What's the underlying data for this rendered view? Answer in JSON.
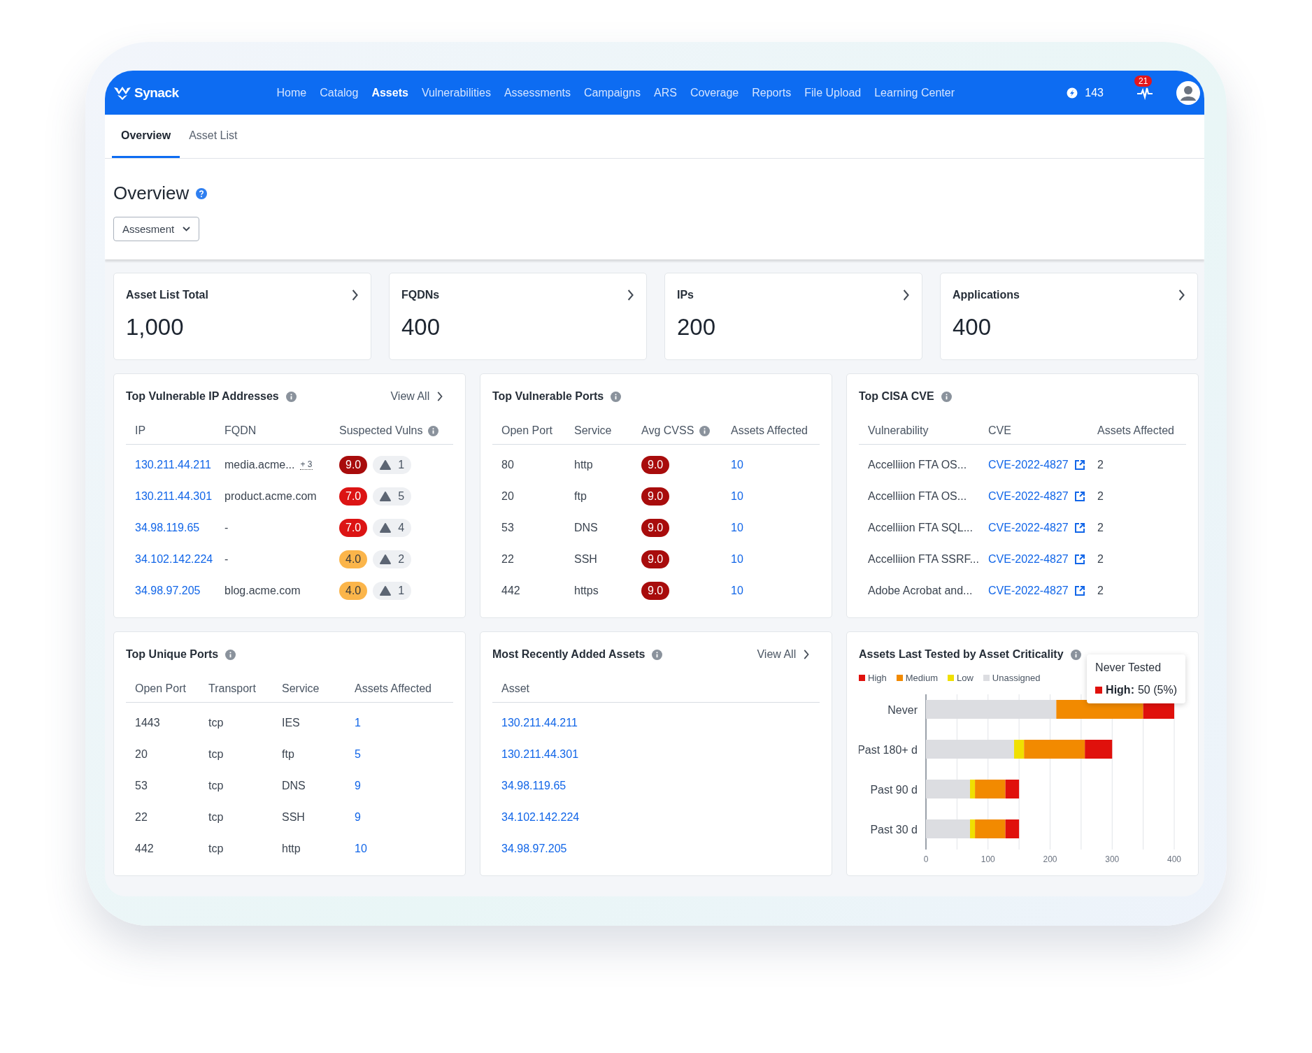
{
  "nav": {
    "logo": "Synack",
    "items": [
      {
        "label": "Home",
        "selected": false
      },
      {
        "label": "Catalog",
        "selected": false
      },
      {
        "label": "Assets",
        "selected": true
      },
      {
        "label": "Vulnerabilities",
        "selected": false
      },
      {
        "label": "Assessments",
        "selected": false
      },
      {
        "label": "Campaigns",
        "selected": false
      },
      {
        "label": "ARS",
        "selected": false
      },
      {
        "label": "Coverage",
        "selected": false
      },
      {
        "label": "Reports",
        "selected": false
      },
      {
        "label": "File Upload",
        "selected": false
      },
      {
        "label": "Learning Center",
        "selected": false
      }
    ],
    "points": "143",
    "notifications": "21"
  },
  "tabs": [
    {
      "label": "Overview",
      "selected": true
    },
    {
      "label": "Asset List",
      "selected": false
    }
  ],
  "page": {
    "title": "Overview",
    "filter": "Assesment"
  },
  "stats": [
    {
      "label": "Asset List Total",
      "value": "1,000"
    },
    {
      "label": "FQDNs",
      "value": "400"
    },
    {
      "label": "IPs",
      "value": "200"
    },
    {
      "label": "Applications",
      "value": "400"
    }
  ],
  "vulnerable_ips": {
    "title": "Top Vulnerable IP Addresses",
    "view_all": "View All",
    "columns": [
      "IP",
      "FQDN",
      "Suspected Vulns"
    ],
    "rows": [
      {
        "ip": "130.211.44.211",
        "fqdn": "media.acme...",
        "extra": "+ 3",
        "score": "9.0",
        "color": "#a80c0c",
        "count": "1"
      },
      {
        "ip": "130.211.44.301",
        "fqdn": "product.acme.com",
        "score": "7.0",
        "color": "#dc1414",
        "count": "5"
      },
      {
        "ip": "34.98.119.65",
        "fqdn": "-",
        "score": "7.0",
        "color": "#dc1414",
        "count": "4"
      },
      {
        "ip": "34.102.142.224",
        "fqdn": "-",
        "score": "4.0",
        "color": "#fbb54a",
        "count": "2"
      },
      {
        "ip": "34.98.97.205",
        "fqdn": "blog.acme.com",
        "score": "4.0",
        "color": "#fbb54a",
        "count": "1"
      }
    ]
  },
  "vulnerable_ports": {
    "title": "Top Vulnerable Ports",
    "columns": [
      "Open Port",
      "Service",
      "Avg CVSS",
      "Assets Affected"
    ],
    "rows": [
      {
        "port": "80",
        "service": "http",
        "score": "9.0",
        "color": "#a80c0c",
        "assets": "10"
      },
      {
        "port": "20",
        "service": "ftp",
        "score": "9.0",
        "color": "#a80c0c",
        "assets": "10"
      },
      {
        "port": "53",
        "service": "DNS",
        "score": "9.0",
        "color": "#a80c0c",
        "assets": "10"
      },
      {
        "port": "22",
        "service": "SSH",
        "score": "9.0",
        "color": "#a80c0c",
        "assets": "10"
      },
      {
        "port": "442",
        "service": "https",
        "score": "9.0",
        "color": "#a80c0c",
        "assets": "10"
      }
    ]
  },
  "cisa_cve": {
    "title": "Top CISA CVE",
    "columns": [
      "Vulnerability",
      "CVE",
      "Assets Affected"
    ],
    "rows": [
      {
        "vulnerability": "Accelliion FTA OS...",
        "cve": "CVE-2022-4827",
        "assets": "2"
      },
      {
        "vulnerability": "Accelliion FTA OS...",
        "cve": "CVE-2022-4827",
        "assets": "2"
      },
      {
        "vulnerability": "Accelliion FTA SQL...",
        "cve": "CVE-2022-4827",
        "assets": "2"
      },
      {
        "vulnerability": "Accelliion FTA SSRF...",
        "cve": "CVE-2022-4827",
        "assets": "2"
      },
      {
        "vulnerability": "Adobe Acrobat and...",
        "cve": "CVE-2022-4827",
        "assets": "2"
      }
    ]
  },
  "unique_ports": {
    "title": "Top Unique Ports",
    "columns": [
      "Open Port",
      "Transport",
      "Service",
      "Assets Affected"
    ],
    "rows": [
      {
        "port": "1443",
        "transport": "tcp",
        "service": "IES",
        "assets": "1"
      },
      {
        "port": "20",
        "transport": "tcp",
        "service": "ftp",
        "assets": "5"
      },
      {
        "port": "53",
        "transport": "tcp",
        "service": "DNS",
        "assets": "9"
      },
      {
        "port": "22",
        "transport": "tcp",
        "service": "SSH",
        "assets": "9"
      },
      {
        "port": "442",
        "transport": "tcp",
        "service": "http",
        "assets": "10"
      }
    ]
  },
  "recent_assets": {
    "title": "Most Recently Added Assets",
    "view_all": "View All",
    "columns": [
      "Asset"
    ],
    "rows": [
      "130.211.44.211",
      "130.211.44.301",
      "34.98.119.65",
      "34.102.142.224",
      "34.98.97.205"
    ]
  },
  "criticality": {
    "title": "Assets Last Tested by Asset Criticality",
    "chart_data": {
      "type": "bar",
      "orientation": "horizontal",
      "stacked": true,
      "grid": true,
      "categories": [
        "Never",
        "Past 180+ d",
        "Past 90 d",
        "Past 30 d"
      ],
      "series": [
        {
          "name": "High",
          "color": "#e0110c",
          "values": [
            50,
            44,
            22,
            22
          ]
        },
        {
          "name": "Medium",
          "color": "#f28a00",
          "values": [
            140,
            98,
            49,
            49
          ]
        },
        {
          "name": "Low",
          "color": "#f0e000",
          "values": [
            0,
            16,
            8,
            8
          ]
        },
        {
          "name": "Unassigned",
          "color": "#dcdde1",
          "values": [
            210,
            142,
            71,
            71
          ]
        }
      ],
      "xlim": [
        0,
        400
      ],
      "xticks": [
        0,
        100,
        200,
        300,
        400
      ]
    },
    "tooltip": {
      "title": "Never Tested",
      "label": "High:",
      "value": "50 (5%)",
      "color": "#e0110c"
    }
  }
}
